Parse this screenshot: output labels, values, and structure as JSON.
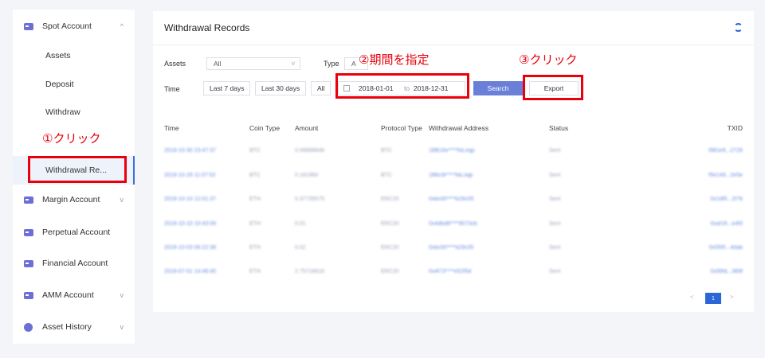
{
  "sidebar": {
    "items": [
      {
        "label": "Spot Account",
        "chevron": "^"
      },
      {
        "label": "Margin Account",
        "chevron": "v"
      },
      {
        "label": "Perpetual Account",
        "chevron": ""
      },
      {
        "label": "Financial Account",
        "chevron": ""
      },
      {
        "label": "AMM Account",
        "chevron": "v"
      },
      {
        "label": "Asset History",
        "chevron": "v"
      }
    ],
    "sub_items": [
      {
        "label": "Assets"
      },
      {
        "label": "Deposit"
      },
      {
        "label": "Withdraw"
      },
      {
        "label": "Withdrawal Re..."
      }
    ]
  },
  "main": {
    "title": "Withdrawal Records",
    "filters": {
      "assets_label": "Assets",
      "assets_value": "All",
      "type_label": "Type",
      "type_value": "A",
      "time_label": "Time",
      "quick_ranges": [
        "Last 7 days",
        "Last 30 days",
        "All"
      ],
      "date_start": "2018-01-01",
      "date_sep": "to",
      "date_end": "2018-12-31",
      "search_label": "Search",
      "export_label": "Export"
    },
    "columns": [
      "Time",
      "Coin Type",
      "Amount",
      "Protocol Type",
      "Withdrawal Address",
      "Status",
      "TXID"
    ],
    "rows": [
      {
        "time": "2018-10-30 23:47:37",
        "coin": "BTC",
        "amount": "0.08868848",
        "protocol": "BTC",
        "address": "1BB16x****NiLoqp",
        "status": "Sent",
        "txid": "f981e6...2726"
      },
      {
        "time": "2018-10-29 11:07:52",
        "coin": "BTC",
        "amount": "0.161984",
        "protocol": "BTC",
        "address": "1B6c9r****NiLoqp",
        "status": "Sent",
        "txid": "f5e149...2e5e"
      },
      {
        "time": "2018-10-10 12:01:37",
        "coin": "ETH",
        "amount": "0.37735575",
        "protocol": "ERC20",
        "address": "0xbc00****b29c05",
        "status": "Sent",
        "txid": "0x1df5...2f7b"
      },
      {
        "time": "2018-10-10 10:43:09",
        "coin": "ETH",
        "amount": "0.01",
        "protocol": "ERC20",
        "address": "0x4dbd8****9073cb",
        "status": "Sent",
        "txid": "0xaf16...e4f0"
      },
      {
        "time": "2018-10-03 06:22:38",
        "coin": "ETH",
        "amount": "0.02",
        "protocol": "ERC20",
        "address": "0xbc00****b29c05",
        "status": "Sent",
        "txid": "0x05f5...4dab"
      },
      {
        "time": "2018-07-01 14:48:45",
        "coin": "ETH",
        "amount": "2.75716816",
        "protocol": "ERC20",
        "address": "0x4f73****e52f5d",
        "status": "Sent",
        "txid": "0x99fd...389f"
      }
    ],
    "pager": {
      "prev": "<",
      "page": "1",
      "next": ">"
    }
  },
  "annotations": {
    "step1": "①クリック",
    "step2": "②期間を指定",
    "step3": "③クリック",
    "color": "#e8000b"
  }
}
